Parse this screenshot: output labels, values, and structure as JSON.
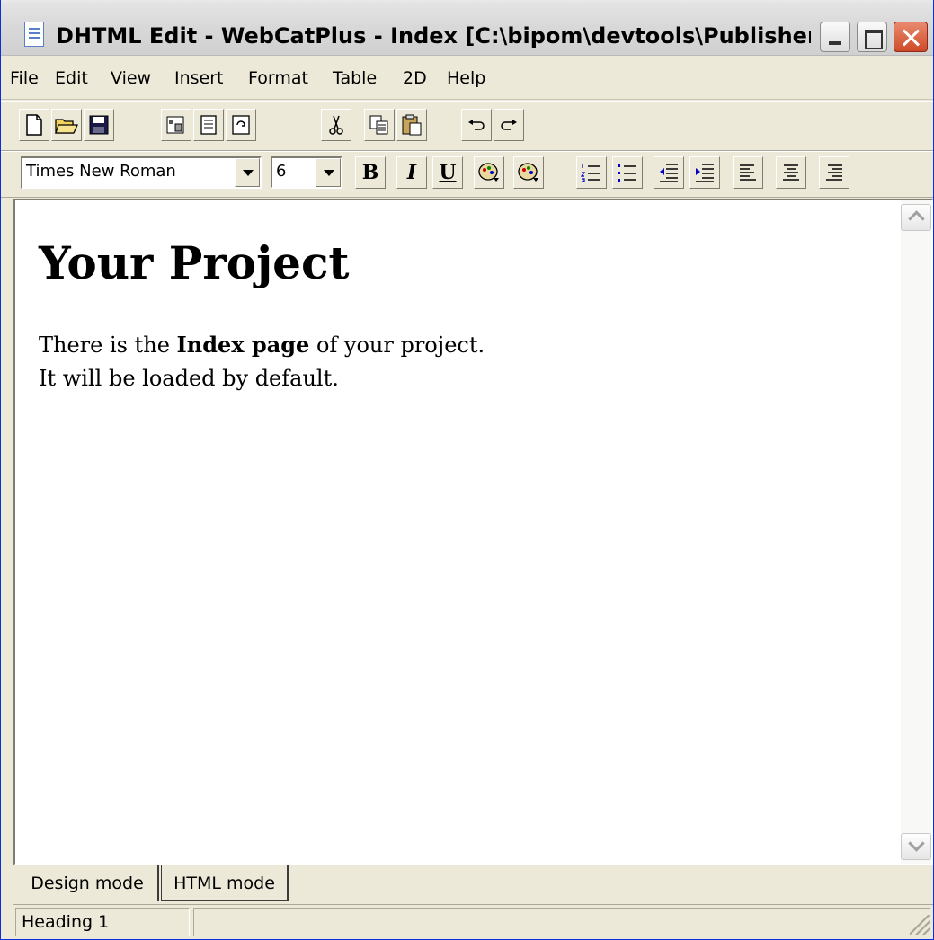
{
  "window": {
    "title": "DHTML Edit - WebCatPlus - Index [C:\\bipom\\devtools\\Publisher\\E...",
    "icon": "document-icon"
  },
  "menu": {
    "items": [
      "File",
      "Edit",
      "View",
      "Insert",
      "Format",
      "Table",
      "2D",
      "Help"
    ]
  },
  "toolbar": {
    "buttons": [
      {
        "name": "new-icon"
      },
      {
        "name": "open-folder-icon"
      },
      {
        "name": "save-disk-icon"
      },
      {
        "name": "properties-icon"
      },
      {
        "name": "document-view-icon"
      },
      {
        "name": "refresh-icon"
      },
      {
        "name": "cut-icon"
      },
      {
        "name": "copy-icon"
      },
      {
        "name": "paste-icon"
      },
      {
        "name": "undo-icon"
      },
      {
        "name": "redo-icon"
      }
    ]
  },
  "format_bar": {
    "font_name": "Times New Roman",
    "font_size": "6",
    "bold_label": "B",
    "italic_label": "I",
    "underline_label": "U",
    "icons": [
      "foreground-color-icon",
      "background-color-icon",
      "numbered-list-icon",
      "bulleted-list-icon",
      "outdent-icon",
      "indent-icon",
      "align-left-icon",
      "align-center-icon",
      "align-right-icon"
    ]
  },
  "document": {
    "heading": "Your Project",
    "line1_prefix": "There is the ",
    "line1_bold": "Index page",
    "line1_suffix": " of your project.",
    "line2": "It will be loaded by default."
  },
  "tabs": {
    "design": "Design mode",
    "html": "HTML mode",
    "active": "Design mode"
  },
  "status": {
    "block_format": "Heading 1",
    "message": ""
  },
  "colors": {
    "title_close": "#cf4a26",
    "chrome": "#ece9d8",
    "editor_bg": "#ffffff"
  }
}
